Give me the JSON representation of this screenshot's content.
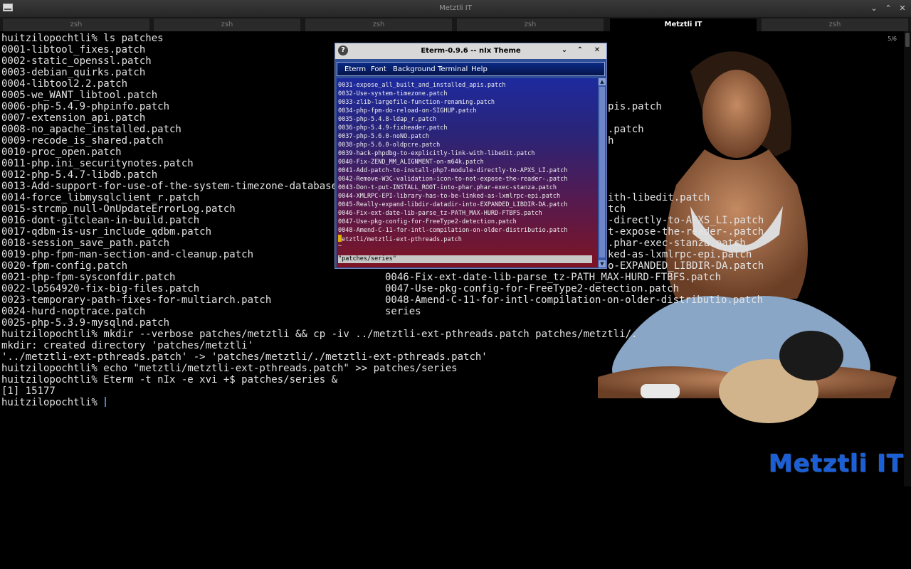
{
  "window": {
    "title": "Metztli IT"
  },
  "tabs": [
    {
      "label": "zsh",
      "active": false
    },
    {
      "label": "zsh",
      "active": false
    },
    {
      "label": "zsh",
      "active": false
    },
    {
      "label": "zsh",
      "active": false
    },
    {
      "label": "Metztli IT",
      "active": true
    },
    {
      "label": "zsh",
      "active": false
    }
  ],
  "page_counter": "5/6",
  "terminal": {
    "left_lines": [
      "huitzilopochtli% ls patches",
      "0001-libtool_fixes.patch",
      "0002-static_openssl.patch",
      "0003-debian_quirks.patch",
      "0004-libtool2.2.patch",
      "0005-we_WANT_libtool.patch",
      "0006-php-5.4.9-phpinfo.patch",
      "0007-extension_api.patch",
      "0008-no_apache_installed.patch",
      "0009-recode_is_shared.patch",
      "0010-proc_open.patch",
      "0011-php.ini_securitynotes.patch",
      "0012-php-5.4.7-libdb.patch",
      "0013-Add-support-for-use-of-the-system-timezone-database",
      "0014-force_libmysqlclient_r.patch",
      "0015-strcmp_null-OnUpdateErrorLog.patch",
      "0016-dont-gitclean-in-build.patch",
      "0017-qdbm-is-usr_include_qdbm.patch",
      "0018-session_save_path.patch",
      "0019-php-fpm-man-section-and-cleanup.patch",
      "0020-fpm-config.patch",
      "0021-php-fpm-sysconfdir.patch",
      "0022-lp564920-fix-big-files.patch",
      "0023-temporary-path-fixes-for-multiarch.patch",
      "0024-hurd-noptrace.patch",
      "0025-php-5.3.9-mysqlnd.patch",
      "huitzilopochtli% mkdir --verbose patches/metztli && cp -iv ../metztli-ext-pthreads.patch patches/metztli/.",
      "mkdir: created directory 'patches/metztli'",
      "'../metztli-ext-pthreads.patch' -> 'patches/metztli/./metztli-ext-pthreads.patch'",
      "huitzilopochtli% echo \"metztli/metztli-ext-pthreads.patch\" >> patches/series",
      "huitzilopochtli% Eterm -t nIx -e xvi +$ patches/series &",
      "[1] 15177",
      "huitzilopochtli% "
    ],
    "right_fragments": [
      {
        "row": 6,
        "text": "pis.patch"
      },
      {
        "row": 8,
        "text": ".patch"
      },
      {
        "row": 9,
        "text": "h"
      },
      {
        "row": 14,
        "text": "ith-libedit.patch"
      },
      {
        "row": 15,
        "text": "tch"
      },
      {
        "row": 16,
        "text": "-directly-to-APXS_LI.patch"
      },
      {
        "row": 17,
        "text": "t-expose-the-reader-.patch"
      },
      {
        "row": 18,
        "text": ".phar-exec-stanza.patch"
      },
      {
        "row": 19,
        "text": "ked-as-lxmlrpc-epi.patch"
      },
      {
        "row": 20,
        "text": "o-EXPANDED_LIBDIR-DA.patch"
      }
    ],
    "mid_lines": [
      {
        "row": 21,
        "text": "0046-Fix-ext-date-lib-parse_tz-PATH_MAX-HURD-FTBFS.patch"
      },
      {
        "row": 22,
        "text": "0047-Use-pkg-config-for-FreeType2-detection.patch"
      },
      {
        "row": 23,
        "text": "0048-Amend-C-11-for-intl-compilation-on-older-distributio.patch"
      },
      {
        "row": 24,
        "text": "series"
      }
    ]
  },
  "eterm": {
    "title": "Eterm-0.9.6 -- nIx Theme",
    "menu": [
      "Eterm",
      "Font",
      "Background",
      "Terminal",
      "Help"
    ],
    "lines": [
      "0031-expose_all_built_and_installed_apis.patch",
      "0032-Use-system-timezone.patch",
      "0033-zlib-largefile-function-renaming.patch",
      "0034-php-fpm-do-reload-on-SIGHUP.patch",
      "0035-php-5.4.8-ldap_r.patch",
      "0036-php-5.4.9-fixheader.patch",
      "0037-php-5.6.0-noNO.patch",
      "0038-php-5.6.0-oldpcre.patch",
      "0039-hack-phpdbg-to-explicitly-link-with-libedit.patch",
      "0040-Fix-ZEND_MM_ALIGNMENT-on-m64k.patch",
      "0041-Add-patch-to-install-php7-module-directly-to-APXS_LI.patch",
      "0042-Remove-W3C-validation-icon-to-not-expose-the-reader-.patch",
      "0043-Don-t-put-INSTALL_ROOT-into-phar.phar-exec-stanza.patch",
      "0044-XMLRPC-EPI-library-has-to-be-linked-as-lxmlrpc-epi.patch",
      "0045-Really-expand-libdir-datadir-into-EXPANDED_LIBDIR-DA.patch",
      "0046-Fix-ext-date-lib-parse_tz-PATH_MAX-HURD-FTBFS.patch",
      "0047-Use-pkg-config-for-FreeType2-detection.patch",
      "0048-Amend-C-11-for-intl-compilation-on-older-distributio.patch"
    ],
    "cursor_line_rest": "etztli/metztli-ext-pthreads.patch",
    "tilde": "~",
    "status": "\"patches/series\""
  },
  "logo": "Metztli IT",
  "colors": {
    "logo": "#1a5fd6",
    "eterm_menu": "#0a2a86",
    "cursor": "#e0b000"
  }
}
